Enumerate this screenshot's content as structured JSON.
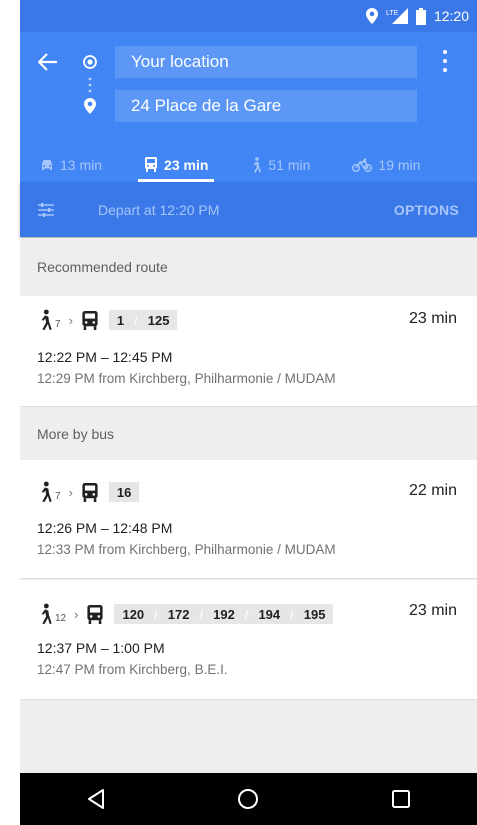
{
  "status_bar": {
    "time": "12:20",
    "network": "LTE"
  },
  "header": {
    "origin_value": "Your location",
    "destination_value": "24 Place de la Gare"
  },
  "modes": [
    {
      "name": "car",
      "label": "13 min"
    },
    {
      "name": "transit",
      "label": "23 min",
      "active": true
    },
    {
      "name": "walk",
      "label": "51 min"
    },
    {
      "name": "bike",
      "label": "19 min"
    }
  ],
  "options_bar": {
    "depart_text": "Depart at 12:20 PM",
    "options_label": "OPTIONS"
  },
  "sections": {
    "recommended": "Recommended route",
    "more_by_bus": "More by bus"
  },
  "routes": [
    {
      "walk_minutes": "7",
      "lines": [
        "1",
        "125"
      ],
      "duration": "23 min",
      "time_range": "12:22 PM – 12:45 PM",
      "from": "12:29 PM from Kirchberg, Philharmonie / MUDAM"
    },
    {
      "walk_minutes": "7",
      "lines": [
        "16"
      ],
      "duration": "22 min",
      "time_range": "12:26 PM – 12:48 PM",
      "from": "12:33 PM from Kirchberg, Philharmonie / MUDAM"
    },
    {
      "walk_minutes": "12",
      "lines": [
        "120",
        "172",
        "192",
        "194",
        "195"
      ],
      "duration": "23 min",
      "time_range": "12:37 PM – 1:00 PM",
      "from": "12:47 PM from Kirchberg, B.E.I."
    }
  ],
  "colors": {
    "primary": "#4285f4",
    "primary_dark": "#3b78e7",
    "inactive_tab": "#a6c6fb"
  }
}
